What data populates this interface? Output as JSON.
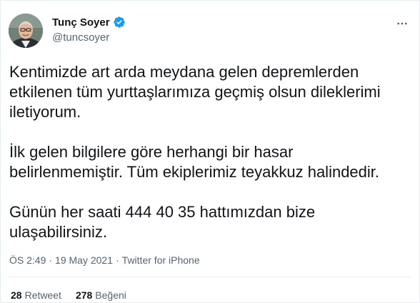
{
  "author": {
    "name": "Tunç Soyer",
    "handle": "@tuncsoyer",
    "verified": true,
    "verified_icon": "verified-badge-icon",
    "more_icon": "more-horizontal-icon"
  },
  "tweet": {
    "paragraphs": [
      "Kentimizde art arda meydana gelen depremlerden etkilenen tüm yurttaşlarımıza geçmiş olsun dileklerimi iletiyorum.",
      "İlk gelen bilgilere göre herhangi bir hasar belirlenmemiştir. Tüm ekiplerimiz teyakkuz halindedir.",
      "Günün her saati 444 40 35 hattımızdan bize ulaşabilirsiniz."
    ],
    "time": "ÖS 2:49",
    "date": "19 May 2021",
    "source": "Twitter for iPhone",
    "separator": "·"
  },
  "stats": {
    "retweets_count": "28",
    "retweets_label": "Retweet",
    "likes_count": "278",
    "likes_label": "Beğeni"
  },
  "colors": {
    "verified_blue": "#1d9bf0",
    "secondary_text": "#536471",
    "border": "#e6ecf0"
  }
}
